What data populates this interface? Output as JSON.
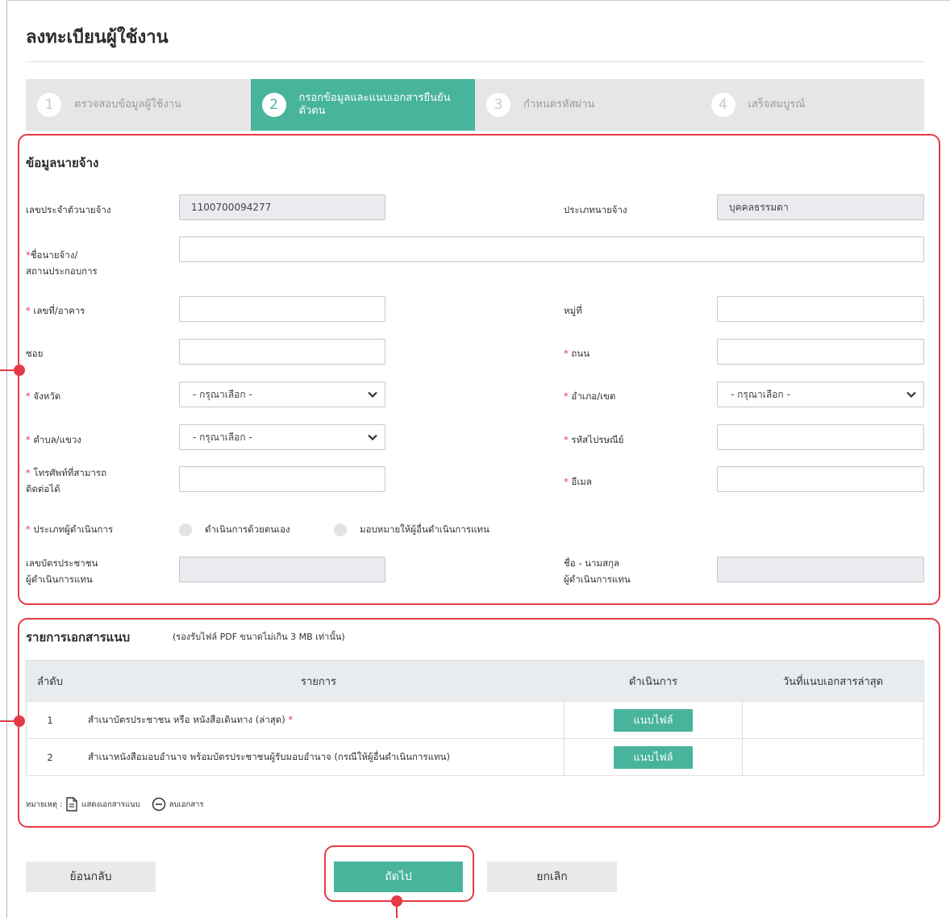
{
  "page": {
    "title": "ลงทะเบียนผู้ใช้งาน"
  },
  "stepper": {
    "steps": [
      {
        "num": "1",
        "label": "ตรวจสอบข้อมูลผู้ใช้งาน",
        "active": false
      },
      {
        "num": "2",
        "label": "กรอกข้อมูลและแนบเอกสารยืนยันตัวตน",
        "active": true
      },
      {
        "num": "3",
        "label": "กำหนดรหัสผ่าน",
        "active": false
      },
      {
        "num": "4",
        "label": "เสร็จสมบูรณ์",
        "active": false
      }
    ]
  },
  "employer": {
    "section_title": "ข้อมูลนายจ้าง",
    "employer_id_label": "เลขประจำตัวนายจ้าง",
    "employer_id_value": "1100700094277",
    "employer_type_label": "ประเภทนายจ้าง",
    "employer_type_value": "บุคคลธรรมดา",
    "name_label_line1": "ชื่อนายจ้าง/",
    "name_label_line2": "สถานประกอบการ",
    "house_no_label": "เลขที่/อาคาร",
    "moo_label": "หมู่ที่",
    "soi_label": "ซอย",
    "road_label": "ถนน",
    "province_label": "จังหวัด",
    "district_label": "อำเภอ/เขต",
    "subdistrict_label": "ตำบล/แขวง",
    "postcode_label": "รหัสไปรษณีย์",
    "phone_label_line1": "โทรศัพท์ที่สามารถ",
    "phone_label_line2": "ติดต่อได้",
    "email_label": "อีเมล",
    "select_placeholder": "- กรุณาเลือก -",
    "operator_type_label": "ประเภทผู้ดำเนินการ",
    "operator_self": "ดำเนินการด้วยตนเอง",
    "operator_proxy": "มอบหมายให้ผู้อื่นดำเนินการแทน",
    "proxy_id_label_line1": "เลขบัตรประชาชน",
    "proxy_id_label_line2": "ผู้ดำเนินการแทน",
    "proxy_name_label_line1": "ชื่อ - นามสกุล",
    "proxy_name_label_line2": "ผู้ดำเนินการแทน",
    "required_mark": "*"
  },
  "documents": {
    "section_title": "รายการเอกสารแนบ",
    "note": "(รองรับไฟล์ PDF ขนาดไม่เกิน 3 MB เท่านั้น)",
    "headers": {
      "no": "ลำดับ",
      "item": "รายการ",
      "action": "ดำเนินการ",
      "date": "วันที่แนบเอกสารล่าสุด"
    },
    "rows": [
      {
        "no": "1",
        "item": "สำเนาบัตรประชาชน หรือ หนังสือเดินทาง (ล่าสุด)",
        "required": "*",
        "action": "แนบไฟล์",
        "date": ""
      },
      {
        "no": "2",
        "item": "สำเนาหนังสือมอบอำนาจ พร้อมบัตรประชาชนผู้รับมอบอำนาจ (กรณีให้ผู้อื่นดำเนินการแทน)",
        "required": "",
        "action": "แนบไฟล์",
        "date": ""
      }
    ],
    "legend_prefix": "หมายเหตุ :",
    "legend_view": "แสดงเอกสารแนบ",
    "legend_delete": "ลบเอกสาร"
  },
  "actions": {
    "back": "ย้อนกลับ",
    "next": "ถัดไป",
    "cancel": "ยกเลิก"
  },
  "colors": {
    "accent": "#48b49c",
    "annotation": "#e53a46",
    "disabled_bg": "#e9ebee",
    "stepper_bg": "#e6e6e6"
  }
}
